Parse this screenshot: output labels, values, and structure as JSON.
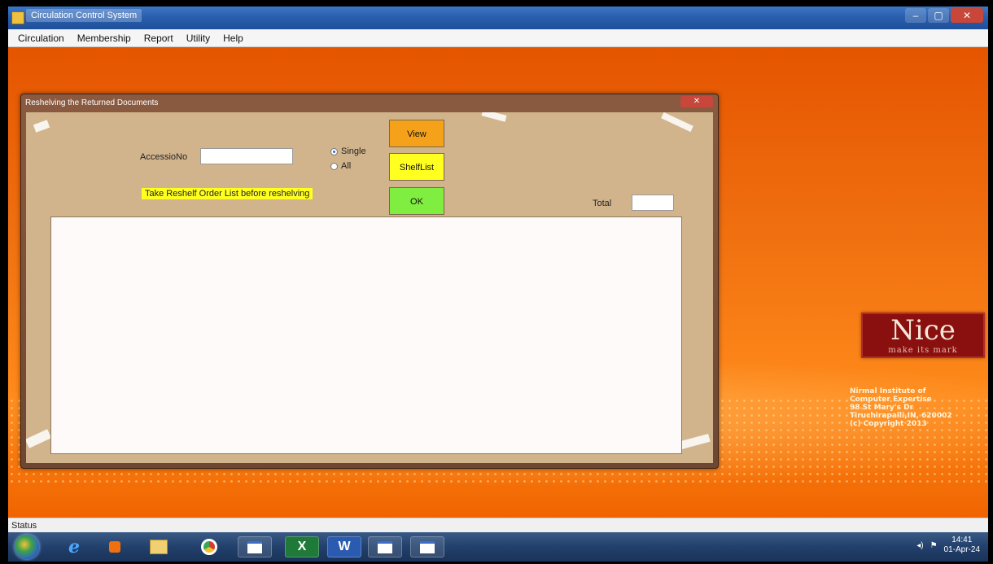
{
  "window": {
    "title": "Circulation Control System",
    "minimize": "–",
    "maximize": "▢",
    "close": "✕"
  },
  "menu": [
    "Circulation",
    "Membership",
    "Report",
    "Utility",
    "Help"
  ],
  "dialog": {
    "title": "Reshelving the Returned Documents",
    "close": "✕",
    "accession_label": "AccessioNo",
    "accession_value": "",
    "radio_single": "Single",
    "radio_all": "All",
    "selected": "Single",
    "notice": "Take Reshelf Order List before reshelving",
    "btn_view": "View",
    "btn_shelflist": "ShelfList",
    "btn_ok": "OK",
    "total_label": "Total",
    "total_value": ""
  },
  "branding": {
    "logo": "Nice",
    "tagline": "make its mark",
    "lines": [
      "Nirmal Institute of",
      "Computer Expertise",
      "98 St Mary's Dr",
      "Tiruchirapalli,IN, 620002",
      "(c) Copyright 2013"
    ]
  },
  "status": {
    "text": "Status"
  },
  "taskbar": {
    "time": "14:41",
    "date": "01-Apr-24",
    "apps": [
      "internet-explorer",
      "media-player",
      "file-explorer",
      "chrome",
      "window",
      "excel",
      "word",
      "window",
      "window"
    ]
  },
  "colors": {
    "background_orange": "#f07010",
    "dialog_body": "#d2b48c",
    "view_button": "#f5a21a",
    "shelflist_button": "#ffff20",
    "ok_button": "#80ee40"
  }
}
